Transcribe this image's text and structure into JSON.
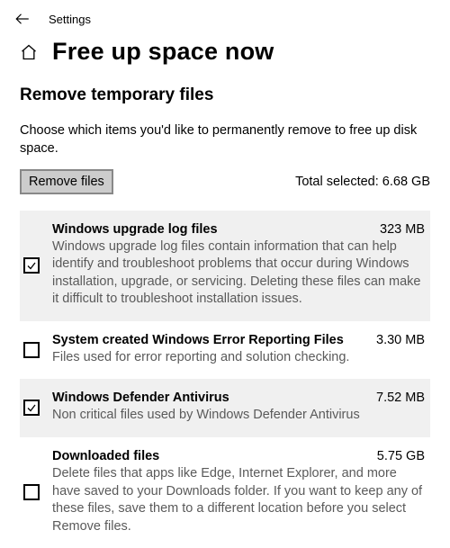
{
  "app_title": "Settings",
  "page_title": "Free up space now",
  "section_title": "Remove temporary files",
  "section_desc": "Choose which items you'd like to permanently remove to free up disk space.",
  "remove_button_label": "Remove files",
  "total_selected_label": "Total selected: 6.68 GB",
  "items": [
    {
      "title": "Windows upgrade log files",
      "size": "323 MB",
      "desc": "Windows upgrade log files contain information that can help identify and troubleshoot problems that occur during Windows installation, upgrade, or servicing.  Deleting these files can make it difficult to troubleshoot installation issues.",
      "checked": true,
      "shaded": true
    },
    {
      "title": "System created Windows Error Reporting Files",
      "size": "3.30 MB",
      "desc": "Files used for error reporting and solution checking.",
      "checked": false,
      "shaded": false
    },
    {
      "title": "Windows Defender Antivirus",
      "size": "7.52 MB",
      "desc": "Non critical files used by Windows Defender Antivirus",
      "checked": true,
      "shaded": true
    },
    {
      "title": "Downloaded files",
      "size": "5.75 GB",
      "desc": "Delete files that apps like Edge, Internet Explorer, and more have saved to your Downloads folder. If you want to keep any of these files, save them to a different location before you select Remove files.",
      "checked": false,
      "shaded": false
    }
  ]
}
